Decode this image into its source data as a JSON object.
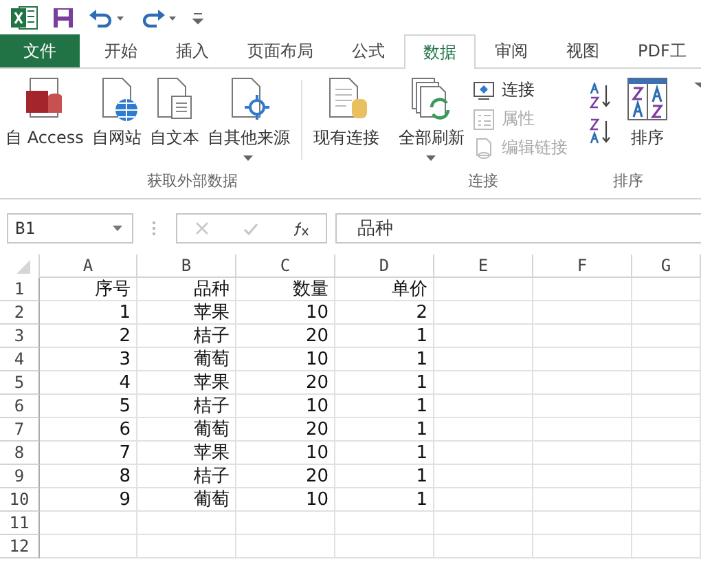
{
  "tabs": [
    {
      "label": "文件",
      "kind": "file",
      "selected": false
    },
    {
      "label": "开始",
      "kind": "tab",
      "selected": false
    },
    {
      "label": "插入",
      "kind": "tab",
      "selected": false
    },
    {
      "label": "页面布局",
      "kind": "tab",
      "selected": false
    },
    {
      "label": "公式",
      "kind": "tab",
      "selected": false
    },
    {
      "label": "数据",
      "kind": "tab",
      "selected": true
    },
    {
      "label": "审阅",
      "kind": "tab",
      "selected": false
    },
    {
      "label": "视图",
      "kind": "tab",
      "selected": false
    },
    {
      "label": "PDF工",
      "kind": "tab",
      "selected": false
    }
  ],
  "ribbon_groups": [
    {
      "label": "获取外部数据",
      "items": [
        {
          "kind": "large",
          "label": "自 Access",
          "dropdown": false
        },
        {
          "kind": "large",
          "label": "自网站",
          "dropdown": false
        },
        {
          "kind": "large",
          "label": "自文本",
          "dropdown": false
        },
        {
          "kind": "large",
          "label": "自其他来源",
          "dropdown": true
        },
        {
          "kind": "separator"
        },
        {
          "kind": "large",
          "label": "现有连接",
          "dropdown": false
        }
      ]
    },
    {
      "label": "连接",
      "items": [
        {
          "kind": "large",
          "label": "全部刷新",
          "dropdown": true
        },
        {
          "kind": "stack",
          "children": [
            {
              "label": "连接",
              "disabled": false
            },
            {
              "label": "属性",
              "disabled": true
            },
            {
              "label": "编辑链接",
              "disabled": true
            }
          ]
        }
      ]
    },
    {
      "label": "排序",
      "items": [
        {
          "kind": "sortstack"
        },
        {
          "kind": "large",
          "label": "排序",
          "dropdown": false
        }
      ]
    }
  ],
  "name_box": "B1",
  "formula": "品种",
  "columns": [
    "A",
    "B",
    "C",
    "D",
    "E",
    "F",
    "G"
  ],
  "rows": [
    {
      "header": "1",
      "cells": [
        "序号",
        "品种",
        "数量",
        "单价"
      ]
    },
    {
      "header": "2",
      "cells": [
        "1",
        "苹果",
        "10",
        "2"
      ]
    },
    {
      "header": "3",
      "cells": [
        "2",
        "桔子",
        "20",
        "1"
      ]
    },
    {
      "header": "4",
      "cells": [
        "3",
        "葡萄",
        "10",
        "1"
      ]
    },
    {
      "header": "5",
      "cells": [
        "4",
        "苹果",
        "20",
        "1"
      ]
    },
    {
      "header": "6",
      "cells": [
        "5",
        "桔子",
        "10",
        "1"
      ]
    },
    {
      "header": "7",
      "cells": [
        "6",
        "葡萄",
        "20",
        "1"
      ]
    },
    {
      "header": "8",
      "cells": [
        "7",
        "苹果",
        "10",
        "1"
      ]
    },
    {
      "header": "9",
      "cells": [
        "8",
        "桔子",
        "20",
        "1"
      ]
    },
    {
      "header": "10",
      "cells": [
        "9",
        "葡萄",
        "10",
        "1"
      ]
    },
    {
      "header": "11"
    },
    {
      "header": "12"
    }
  ]
}
